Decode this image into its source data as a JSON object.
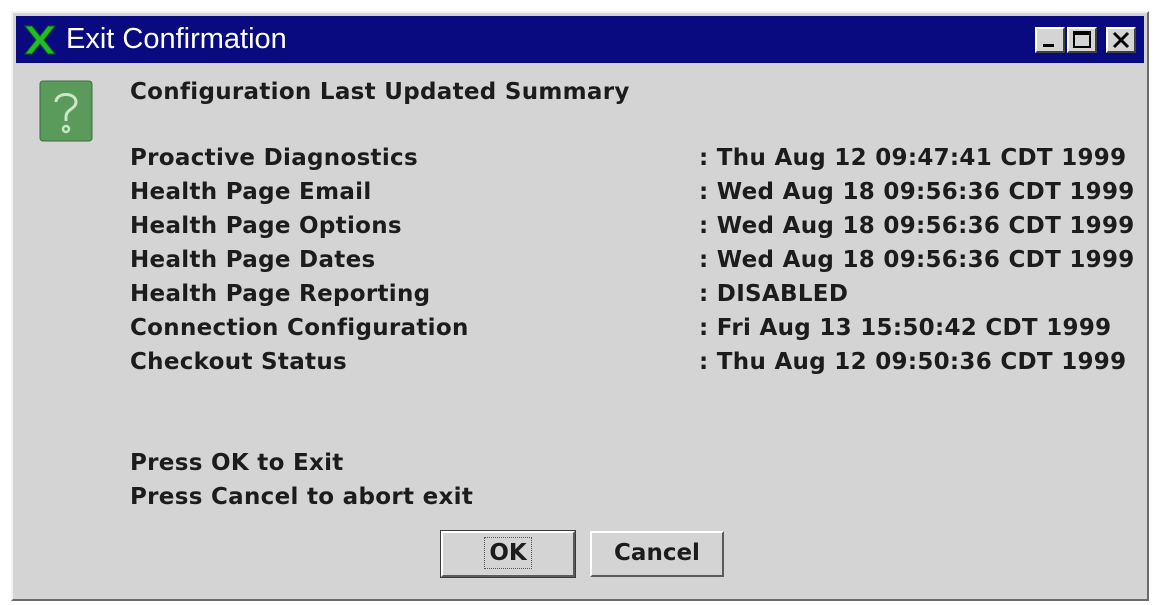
{
  "window": {
    "title": "Exit Confirmation",
    "logo_icon": "x-logo-icon",
    "controls": [
      "minimize-icon",
      "maximize-icon",
      "close-icon"
    ]
  },
  "dialog": {
    "icon": "question-icon",
    "heading": "Configuration Last Updated Summary",
    "rows": [
      {
        "label": "Proactive Diagnostics",
        "value": ": Thu Aug 12 09:47:41 CDT 1999"
      },
      {
        "label": "Health Page Email",
        "value": ": Wed Aug 18 09:56:36 CDT 1999"
      },
      {
        "label": "Health Page Options",
        "value": ": Wed Aug 18 09:56:36 CDT 1999"
      },
      {
        "label": "Health Page Dates",
        "value": ": Wed Aug 18 09:56:36 CDT 1999"
      },
      {
        "label": "Health Page Reporting",
        "value": ": DISABLED"
      },
      {
        "label": "Connection Configuration",
        "value": ": Fri Aug 13 15:50:42 CDT 1999"
      },
      {
        "label": "Checkout Status",
        "value": ": Thu Aug 12 09:50:36 CDT 1999"
      }
    ],
    "instructions": [
      "Press OK to Exit",
      "Press Cancel to abort exit"
    ]
  },
  "buttons": {
    "ok_label": "OK",
    "cancel_label": "Cancel"
  },
  "colors": {
    "titlebar": "#0a0a80",
    "window_bg": "#d4d4d4",
    "logo_green": "#1fbf2a",
    "question_icon_bg": "#5a9a5a"
  }
}
